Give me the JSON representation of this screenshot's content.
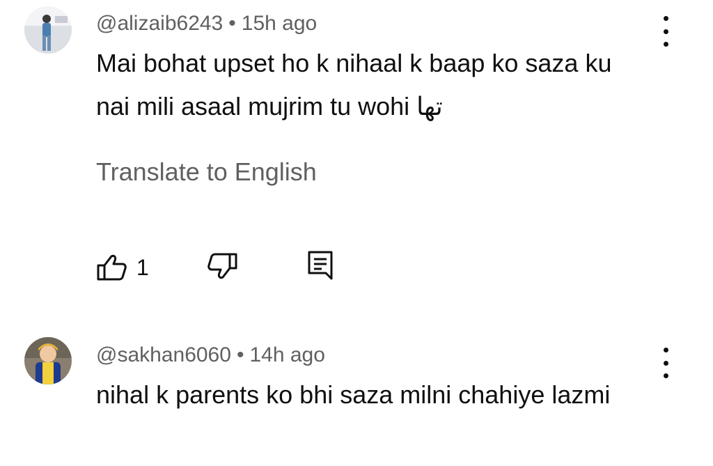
{
  "comments": [
    {
      "handle": "@alizaib6243",
      "separator": "•",
      "time": "15h ago",
      "text": "Mai bohat upset ho k nihaal k baap ko saza ku nai mili asaal mujrim tu wohi",
      "text_urdu": "تھا",
      "translate_label": "Translate to English",
      "likes": "1",
      "avatar_icon": "user-avatar-photo",
      "menu_icon": "more-vertical-icon"
    },
    {
      "handle": "@sakhan6060",
      "separator": "•",
      "time": "14h ago",
      "text": "nihal k parents ko bhi saza milni chahiye lazmi",
      "avatar_icon": "user-avatar-photo",
      "menu_icon": "more-vertical-icon"
    }
  ],
  "icons": {
    "like": "thumb-up-outline-icon",
    "dislike": "thumb-down-outline-icon",
    "reply": "comment-reply-icon"
  },
  "colors": {
    "text_primary": "#0f0f0f",
    "text_secondary": "#606060",
    "background": "#ffffff"
  }
}
